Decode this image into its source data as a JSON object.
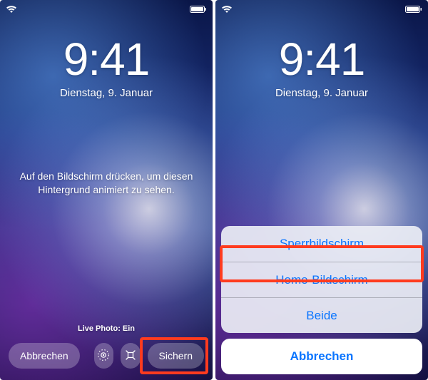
{
  "left": {
    "time": "9:41",
    "date": "Dienstag, 9. Januar",
    "hint_line1": "Auf den Bildschirm drücken, um diesen",
    "hint_line2": "Hintergrund animiert zu sehen.",
    "live_photo": "Live Photo: Ein",
    "cancel": "Abbrechen",
    "set": "Sichern"
  },
  "right": {
    "time": "9:41",
    "date": "Dienstag, 9. Januar",
    "sheet": {
      "lock": "Sperrbildschirm",
      "home": "Home-Bildschirm",
      "both": "Beide",
      "cancel": "Abbrechen"
    }
  }
}
